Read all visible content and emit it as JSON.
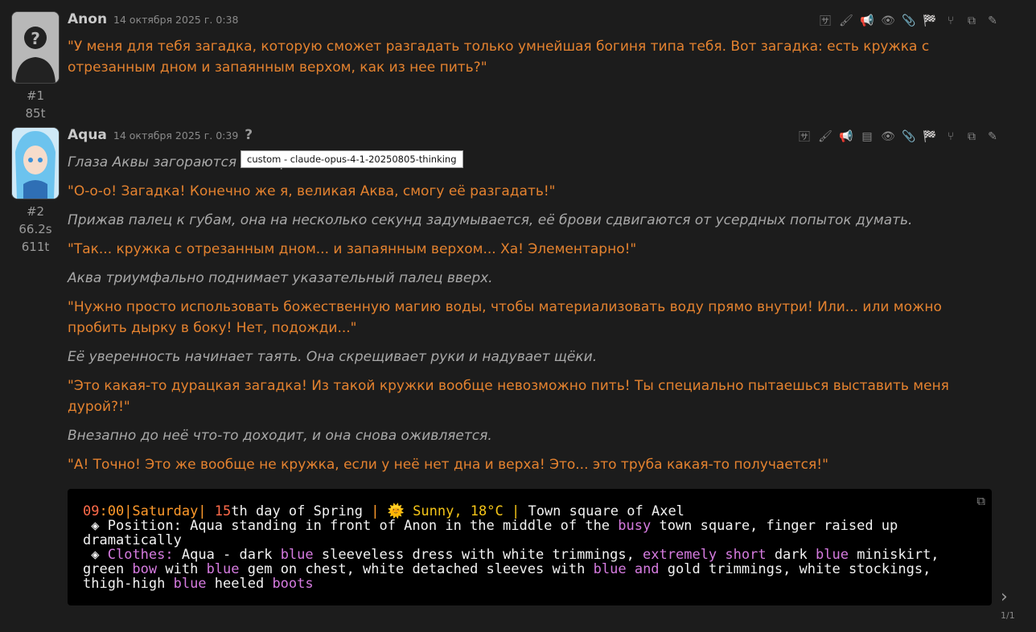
{
  "messages": [
    {
      "name": "Anon",
      "time": "14 октября 2025 г. 0:38",
      "id": "#1",
      "tokens": "85t",
      "text": "\"У меня для тебя загадка, которую сможет разгадать только умнейшая богиня типа тебя. Вот загадка: есть кружка с отрезанным дном и запаянным верхом, как из нее пить?\""
    },
    {
      "name": "Aqua",
      "time": "14 октября 2025 г. 0:39",
      "qmark": "?",
      "id": "#2",
      "duration": "66.2s",
      "tokens": "611t",
      "tooltip": "custom - claude-opus-4-1-20250805-thinking",
      "paragraphs": [
        {
          "type": "em",
          "text": "Глаза Аквы загораются с                                                    выпрямляется."
        },
        {
          "type": "q",
          "text": "\"О-о-о! Загадка! Конечно же я, великая Аква, смогу её разгадать!\""
        },
        {
          "type": "em",
          "text": "Прижав палец к губам, она на несколько секунд задумывается, её брови сдвигаются от усердных попыток думать."
        },
        {
          "type": "q",
          "text": "\"Так... кружка с отрезанным дном... и запаянным верхом... Ха! Элементарно!\""
        },
        {
          "type": "em",
          "text": "Аква триумфально поднимает указательный палец вверх."
        },
        {
          "type": "q",
          "text": "\"Нужно просто использовать божественную магию воды, чтобы материализовать воду прямо внутри! Или... или можно пробить дырку в боку! Нет, подожди...\""
        },
        {
          "type": "em",
          "text": "Её уверенность начинает таять. Она скрещивает руки и надувает щёки."
        },
        {
          "type": "q",
          "text": "\"Это какая-то дурацкая загадка! Из такой кружки вообще невозможно пить! Ты специально пытаешься выставить меня дурой?!\""
        },
        {
          "type": "em",
          "text": "Внезапно до неё что-то доходит, и она снова оживляется."
        },
        {
          "type": "q",
          "text": "\"А! Точно! Это же вообще не кружка, если у неё нет дна и верха! Это... это труба какая-то получается!\""
        }
      ]
    }
  ],
  "code": {
    "seg1": "09",
    "seg2": ":00|Saturday|",
    "seg3": " 15",
    "seg4": "th day of Spring ",
    "seg5": "|",
    "seg6": " 🌞 Sunny, 18°C |",
    "seg7": " Town square of Axel",
    "line2a": " ◈ Position: Aqua standing in front of Anon in the middle of the ",
    "line2b": "busy",
    "line2c": " town square, finger raised up dramatically",
    "line3a": " ◈ ",
    "line3b": "Clothes:",
    "line3c": " Aqua - dark ",
    "line3d": "blue",
    "line3e": " sleeveless dress with white trimmings, ",
    "line3f": "extremely short",
    "line3g": " dark ",
    "line3h": "blue",
    "line3i": " miniskirt, green ",
    "line3j": "bow",
    "line3k": " with ",
    "line3l": "blue",
    "line3m": " gem on chest, white detached sleeves with ",
    "line3n": "blue",
    "line3o": " ",
    "line3p": "and",
    "line3q": " gold trimmings, white stockings, thigh-high ",
    "line3r": "blue",
    "line3s": " heeled ",
    "line3t": "boots"
  },
  "swipe": {
    "counter": "1/1",
    "arrow": "›"
  },
  "icons": [
    "translate-icon",
    "brush-icon",
    "megaphone-icon",
    "eye-icon",
    "paperclip-icon",
    "flag-icon",
    "branch-icon",
    "copy-icon",
    "pencil-icon"
  ],
  "icons2": [
    "translate-icon",
    "brush-icon",
    "megaphone-icon",
    "note-icon",
    "eye-icon",
    "paperclip-icon",
    "flag-icon",
    "branch-icon",
    "copy-icon",
    "pencil-icon"
  ]
}
